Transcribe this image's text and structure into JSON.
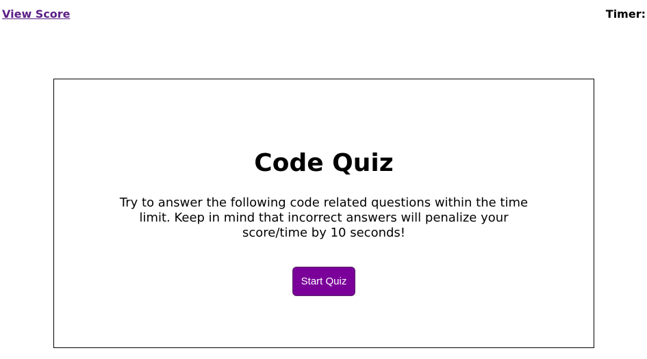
{
  "header": {
    "view_score_label": "View Score",
    "timer_label": "Timer:"
  },
  "quiz": {
    "title": "Code Quiz",
    "description": "Try to answer the following code related questions within the time limit. Keep in mind that incorrect answers will penalize your score/time by 10 seconds!",
    "start_button_label": "Start Quiz"
  },
  "colors": {
    "link": "#5b1f86",
    "button_bg": "#7a0099",
    "button_text": "#ffffff",
    "border": "#000000"
  }
}
